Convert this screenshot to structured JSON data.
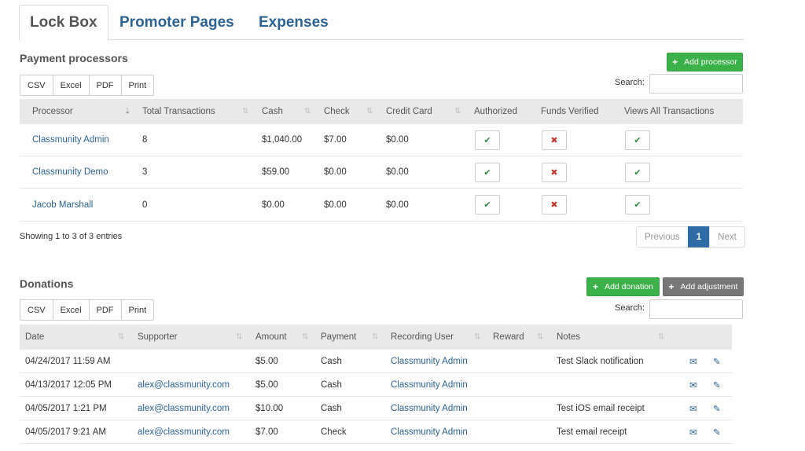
{
  "tabs": [
    {
      "label": "Lock Box"
    },
    {
      "label": "Promoter Pages"
    },
    {
      "label": "Expenses"
    }
  ],
  "processors": {
    "title": "Payment processors",
    "add_label": "Add processor",
    "export": [
      "CSV",
      "Excel",
      "PDF",
      "Print"
    ],
    "search_label": "Search:",
    "search_value": "",
    "columns": [
      "Processor",
      "Total Transactions",
      "Cash",
      "Check",
      "Credit Card",
      "Authorized",
      "Funds Verified",
      "Views All Transactions"
    ],
    "rows": [
      {
        "processor": "Classmunity Admin",
        "total": "8",
        "cash": "$1,040.00",
        "check": "$7.00",
        "credit": "$0.00",
        "authorized": true,
        "funds_verified": false,
        "views_all": true
      },
      {
        "processor": "Classmunity Demo",
        "total": "3",
        "cash": "$59.00",
        "check": "$0.00",
        "credit": "$0.00",
        "authorized": true,
        "funds_verified": false,
        "views_all": true
      },
      {
        "processor": "Jacob Marshall",
        "total": "0",
        "cash": "$0.00",
        "check": "$0.00",
        "credit": "$0.00",
        "authorized": true,
        "funds_verified": false,
        "views_all": true
      }
    ],
    "info": "Showing 1 to 3 of 3 entries",
    "pager": {
      "previous": "Previous",
      "current": "1",
      "next": "Next"
    }
  },
  "donations": {
    "title": "Donations",
    "add_donation_label": "Add donation",
    "add_adjustment_label": "Add adjustment",
    "export": [
      "CSV",
      "Excel",
      "PDF",
      "Print"
    ],
    "search_label": "Search:",
    "search_value": "",
    "columns": [
      "Date",
      "Supporter",
      "Amount",
      "Payment",
      "Recording User",
      "Reward",
      "Notes"
    ],
    "rows": [
      {
        "date": "04/24/2017 11:59 AM",
        "supporter": "",
        "amount": "$5.00",
        "payment": "Cash",
        "user": "Classmunity Admin",
        "reward": "",
        "notes": "Test Slack notification"
      },
      {
        "date": "04/13/2017 12:05 PM",
        "supporter": "alex@classmunity.com",
        "amount": "$5.00",
        "payment": "Cash",
        "user": "Classmunity Admin",
        "reward": "",
        "notes": ""
      },
      {
        "date": "04/05/2017 1:21 PM",
        "supporter": "alex@classmunity.com",
        "amount": "$10.00",
        "payment": "Cash",
        "user": "Classmunity Admin",
        "reward": "",
        "notes": "Test iOS email receipt"
      },
      {
        "date": "04/05/2017 9:21 AM",
        "supporter": "alex@classmunity.com",
        "amount": "$7.00",
        "payment": "Check",
        "user": "Classmunity Admin",
        "reward": "",
        "notes": "Test email receipt"
      }
    ]
  },
  "icons": {
    "plus": "+",
    "check": "✔",
    "cross": "✖",
    "email": "✉",
    "edit": "✎",
    "sort": "⇅",
    "sort_asc": "⇣"
  },
  "colors": {
    "accent": "#2a6496",
    "success": "#3bb14a",
    "danger": "#c0392b",
    "header_bg": "#e9e9e9",
    "page_active": "#2f6ba6"
  }
}
